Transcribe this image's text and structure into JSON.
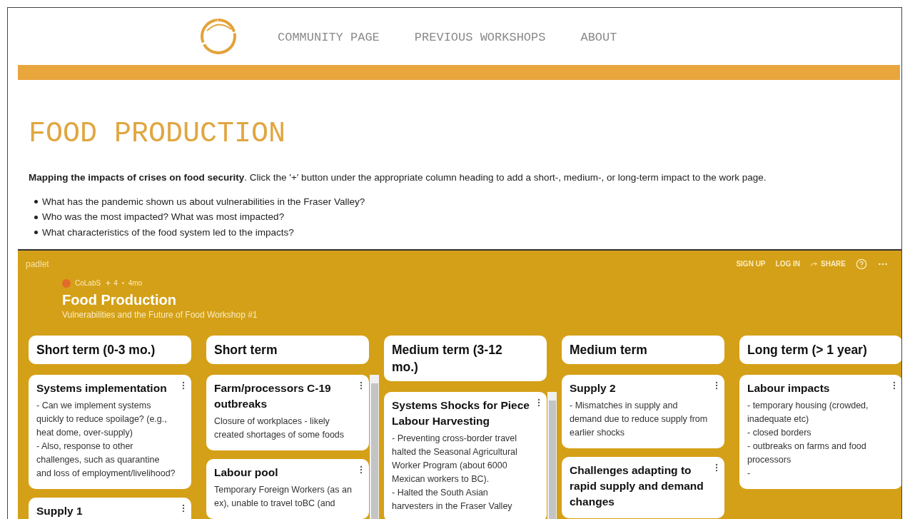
{
  "site": {
    "nav": [
      {
        "label": "COMMUNITY PAGE"
      },
      {
        "label": "PREVIOUS WORKSHOPS"
      },
      {
        "label": "ABOUT"
      }
    ]
  },
  "page": {
    "title": "FOOD PRODUCTION",
    "intro": "**Mapping the impacts of crises on food security**. Click the '+' button under the appropriate column heading to add a short-, medium-, or long-term impact to the work page.",
    "bullets": [
      "What has the pandemic shown us about vulnerabilities in the Fraser Valley?",
      "Who was the most impacted? What was most impacted?",
      "What characteristics of the food system led to the impacts?"
    ]
  },
  "padlet": {
    "brand": "padlet",
    "actions": [
      {
        "kind": "text",
        "label": "SIGN UP"
      },
      {
        "kind": "text",
        "label": "LOG IN"
      },
      {
        "kind": "share",
        "label": "SHARE"
      },
      {
        "kind": "help"
      },
      {
        "kind": "more"
      }
    ],
    "author": "CoLabS",
    "contributors": "4",
    "age": "4mo",
    "title": "Food Production",
    "subtitle": "Vulnerabilities and the Future of Food Workshop #1",
    "columns": [
      {
        "heading": "Short term (0-3 mo.)",
        "scrollbar": false,
        "cards": [
          {
            "title": "Systems implementation",
            "body": [
              "- Can we implement systems quickly to reduce spoilage? (e.g., heat dome, over-supply)",
              "- Also, response to other challenges, such as quarantine and loss of employment/livelihood?"
            ]
          },
          {
            "title": "Supply 1"
          }
        ]
      },
      {
        "heading": "Short term",
        "scrollbar": true,
        "cards": [
          {
            "title": "Farm/processors C-19 outbreaks",
            "body": [
              "Closure of workplaces - likely created shortages of some foods"
            ]
          },
          {
            "title": "Labour pool",
            "body": [
              "Temporary Foreign Workers (as an ex), unable to travel toBC (and"
            ]
          }
        ]
      },
      {
        "heading": "Medium term (3-12 mo.)",
        "scrollbar": true,
        "cards": [
          {
            "title": "Systems Shocks for Piece Labour Harvesting",
            "body": [
              "- Preventing cross-border travel halted the Seasonal Agricultural Worker Program (about 6000 Mexican workers to BC).",
              "- Halted the South Asian harvesters in the Fraser Valley"
            ]
          }
        ]
      },
      {
        "heading": "Medium term",
        "scrollbar": false,
        "cards": [
          {
            "title": "Supply 2",
            "body": [
              "- Mismatches in supply and demand due to reduce supply from earlier shocks"
            ]
          },
          {
            "title": "Challenges adapting to rapid supply and demand changes"
          }
        ]
      },
      {
        "heading": "Long term (> 1 year)",
        "scrollbar": false,
        "cards": [
          {
            "title": "Labour impacts",
            "body": [
              "- temporary housing (crowded, inadequate etc)",
              "- closed borders",
              "- outbreaks on farms and food processors",
              "-"
            ]
          }
        ]
      }
    ]
  }
}
